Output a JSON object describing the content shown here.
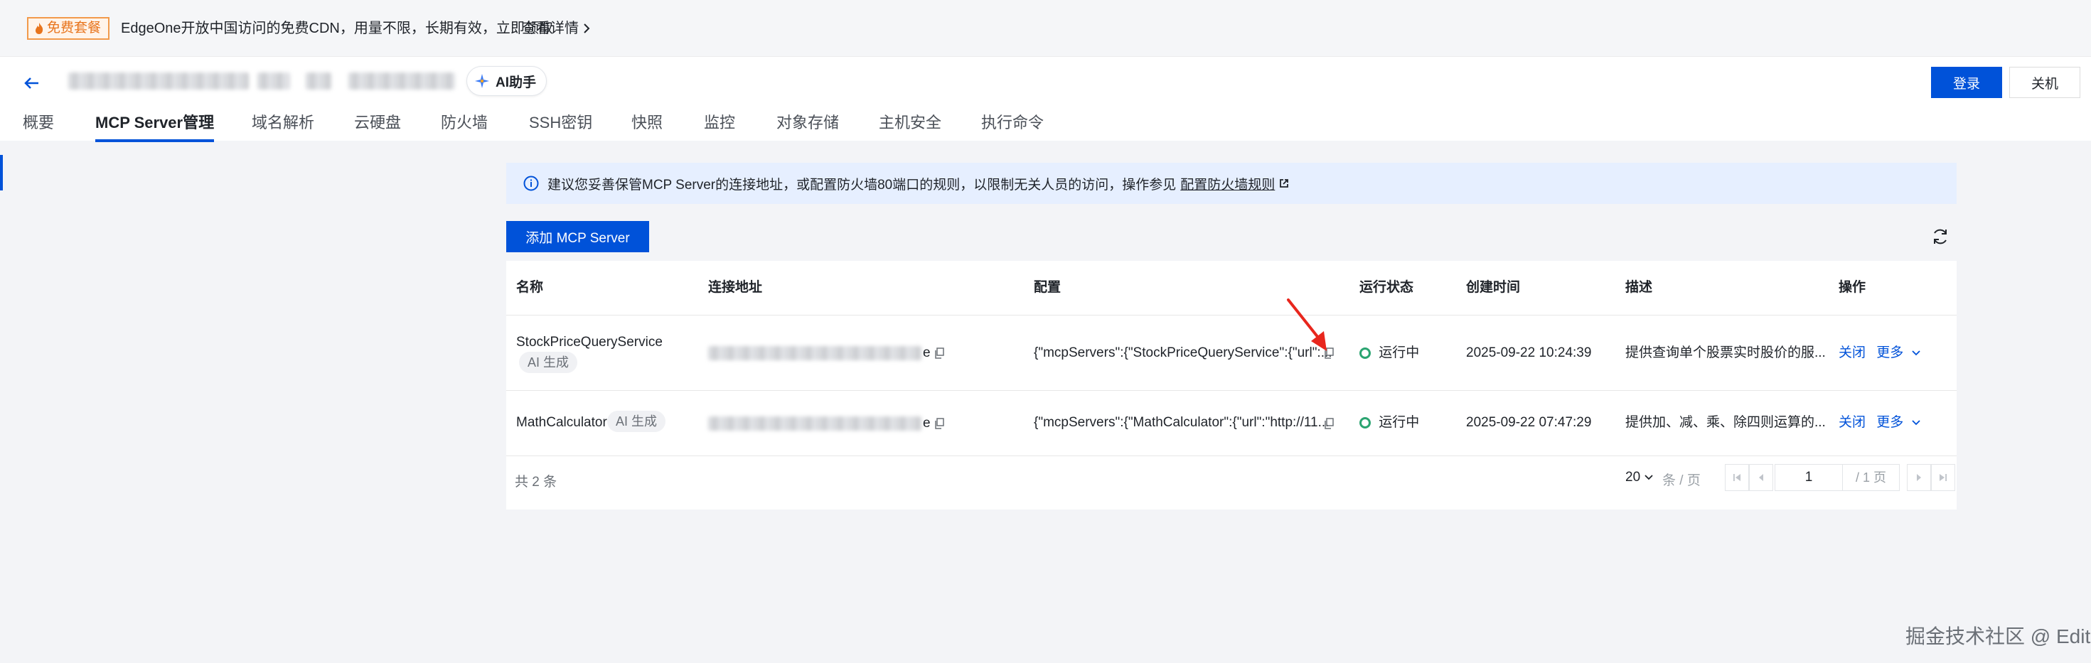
{
  "banner": {
    "badge": "免费套餐",
    "text": "EdgeOne开放中国访问的免费CDN，用量不限，长期有效，立即领取",
    "link": "查看详情"
  },
  "header": {
    "ai_assistant": "AI助手",
    "login": "登录",
    "shutdown": "关机"
  },
  "tabs": [
    "概要",
    "MCP Server管理",
    "域名解析",
    "云硬盘",
    "防火墙",
    "SSH密钥",
    "快照",
    "监控",
    "对象存储",
    "主机安全",
    "执行命令"
  ],
  "notice": {
    "text": "建议您妥善保管MCP Server的连接地址，或配置防火墙80端口的规则，以限制无关人员的访问，操作参见",
    "link": "配置防火墙规则"
  },
  "toolbar": {
    "add_button": "添加 MCP Server"
  },
  "table": {
    "headers": [
      "名称",
      "连接地址",
      "配置",
      "运行状态",
      "创建时间",
      "描述",
      "操作"
    ],
    "rows": [
      {
        "name": "StockPriceQueryService",
        "tag": "AI 生成",
        "address_suffix": "e",
        "config": "{\"mcpServers\":{\"StockPriceQueryService\":{\"url\":...",
        "status": "运行中",
        "created": "2025-09-22 10:24:39",
        "description": "提供查询单个股票实时股价的服...",
        "action_close": "关闭",
        "action_more": "更多"
      },
      {
        "name": "MathCalculator",
        "tag": "AI 生成",
        "address_suffix": "e",
        "config": "{\"mcpServers\":{\"MathCalculator\":{\"url\":\"http://11...",
        "status": "运行中",
        "created": "2025-09-22 07:47:29",
        "description": "提供加、减、乘、除四则运算的...",
        "action_close": "关闭",
        "action_more": "更多"
      }
    ]
  },
  "pagination": {
    "total": "共 2 条",
    "page_size": "20",
    "per_page": "条 / 页",
    "current_page": "1",
    "total_pages": "/ 1 页"
  },
  "watermark": "掘金技术社区 @ Edit",
  "colors": {
    "primary": "#0052d9",
    "running": "#2ba471",
    "notice_bg": "#e6efff",
    "badge": "#e8741c"
  }
}
